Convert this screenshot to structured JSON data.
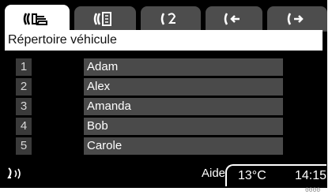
{
  "tabs": [
    {
      "icon": "phone-contacts-icon",
      "active": true
    },
    {
      "icon": "phone-keypad-icon",
      "active": false
    },
    {
      "icon": "phone-redial-icon",
      "active": false
    },
    {
      "icon": "phone-incoming-icon",
      "active": false
    },
    {
      "icon": "phone-outgoing-icon",
      "active": false
    }
  ],
  "header": {
    "title": "Répertoire véhicule"
  },
  "contacts": [
    {
      "number": "1",
      "name": "Adam"
    },
    {
      "number": "2",
      "name": "Alex"
    },
    {
      "number": "3",
      "name": "Amanda"
    },
    {
      "number": "4",
      "name": "Bob"
    },
    {
      "number": "5",
      "name": "Carole"
    }
  ],
  "bottom": {
    "signal_icon": "voice-signal-icon",
    "help_label": "Aide",
    "temperature": "13°C",
    "time": "14:15"
  },
  "reference_code": "0000"
}
